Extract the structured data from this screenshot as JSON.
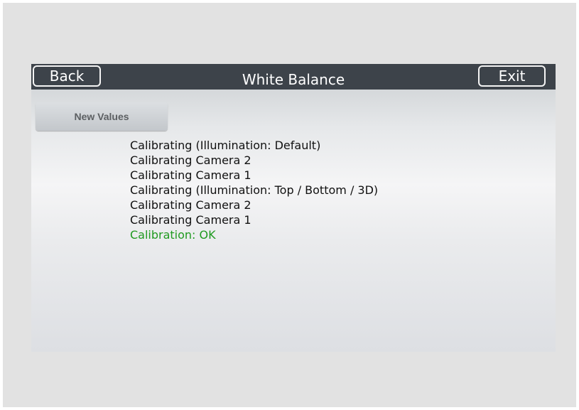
{
  "header": {
    "title": "White Balance",
    "back_label": "Back",
    "exit_label": "Exit"
  },
  "actions": {
    "new_values_label": "New Values"
  },
  "log": {
    "lines": [
      "Calibrating (Illumination: Default)",
      "Calibrating Camera 2",
      "Calibrating Camera 1",
      "Calibrating (Illumination: Top / Bottom / 3D)",
      "Calibrating Camera 2",
      "Calibrating Camera 1"
    ],
    "result": "Calibration: OK"
  },
  "colors": {
    "titlebar": "#3d434a",
    "result_ok": "#1f9a1f",
    "screen_background": "#e2e2e2"
  }
}
